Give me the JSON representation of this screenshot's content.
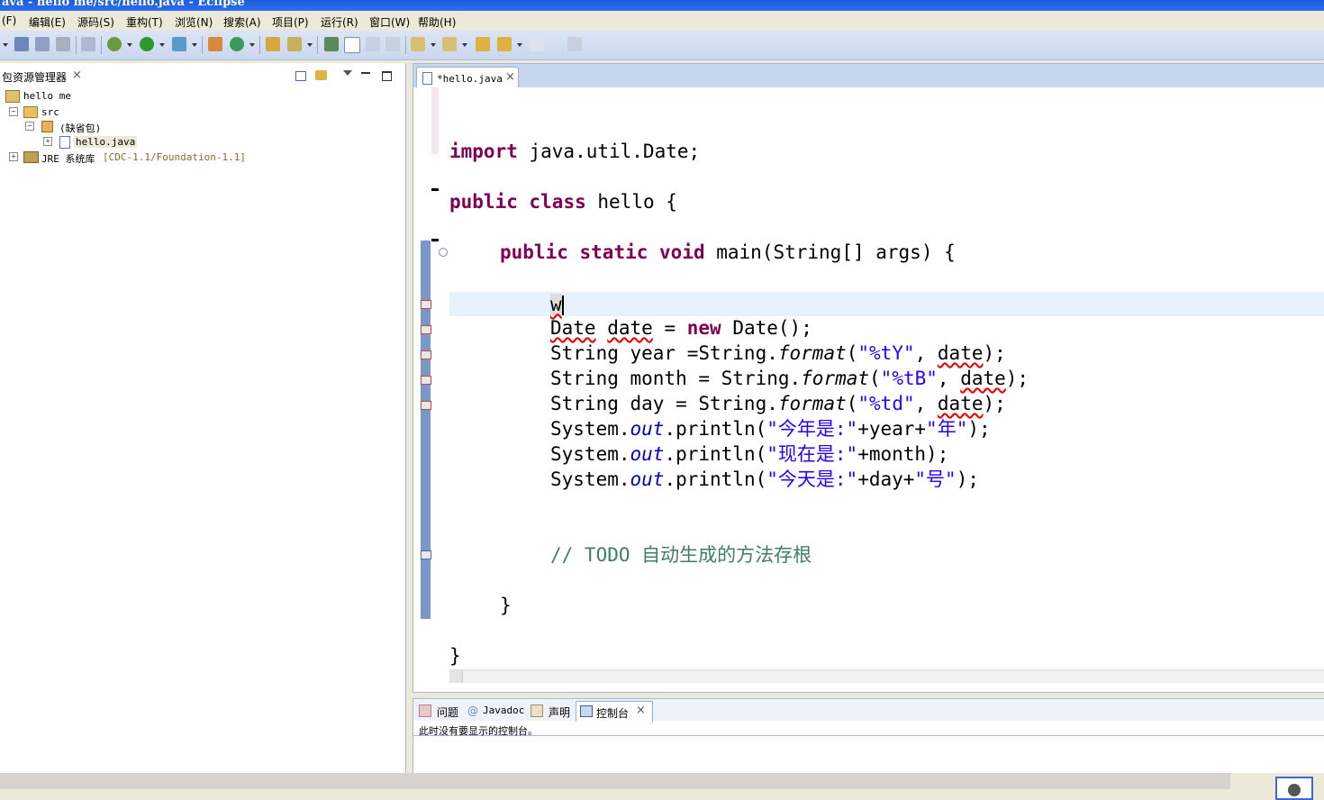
{
  "window": {
    "title": "ava - hello me/src/hello.java - Eclipse"
  },
  "menu": [
    {
      "label": "(F)"
    },
    {
      "label": "编辑(E)"
    },
    {
      "label": "源码(S)"
    },
    {
      "label": "重构(T)"
    },
    {
      "label": "浏览(N)"
    },
    {
      "label": "搜索(A)"
    },
    {
      "label": "项目(P)"
    },
    {
      "label": "运行(R)"
    },
    {
      "label": "窗口(W)"
    },
    {
      "label": "帮助(H)"
    }
  ],
  "package_explorer": {
    "title": "包资源管理器",
    "close": "×",
    "tree": [
      {
        "label": "hello me"
      },
      {
        "label": "src"
      },
      {
        "label": "(缺省包)"
      },
      {
        "label": "hello.java"
      },
      {
        "label": "JRE 系统库",
        "detail": "[CDC-1.1/Foundation-1.1]"
      }
    ]
  },
  "editor": {
    "tab_label": "*hello.java",
    "close": "×",
    "code": {
      "l1_kw": "import",
      "l1_rest": " java.util.Date;",
      "l2_kw1": "public",
      "l2_kw2": "class",
      "l2_rest": " hello {",
      "l3_kw1": "public",
      "l3_kw2": "static",
      "l3_kw3": "void",
      "l3_rest": " main(String[] args) {",
      "l4": "w",
      "l5_a": "Date",
      "l5_b": "date",
      "l5_c": " = ",
      "l5_kw": "new",
      "l5_d": " Date();",
      "l6_a": "String year =String.",
      "l6_it": "format",
      "l6_b": "(",
      "l6_str": "\"%tY\"",
      "l6_c": ", ",
      "l6_d": "date",
      "l6_e": ");",
      "l7_a": "String month = String.",
      "l7_it": "format",
      "l7_b": "(",
      "l7_str": "\"%tB\"",
      "l7_c": ", ",
      "l7_d": "date",
      "l7_e": ");",
      "l8_a": "String day = String.",
      "l8_it": "format",
      "l8_b": "(",
      "l8_str": "\"%td\"",
      "l8_c": ", ",
      "l8_d": "date",
      "l8_e": ");",
      "l9_a": "System.",
      "l9_it": "out",
      "l9_b": ".println(",
      "l9_str1": "\"今年是:\"",
      "l9_c": "+year+",
      "l9_str2": "\"年\"",
      "l9_d": ");",
      "l10_a": "System.",
      "l10_it": "out",
      "l10_b": ".println(",
      "l10_str": "\"现在是:\"",
      "l10_c": "+month);",
      "l11_a": "System.",
      "l11_it": "out",
      "l11_b": ".println(",
      "l11_str1": "\"今天是:\"",
      "l11_c": "+day+",
      "l11_str2": "\"号\"",
      "l11_d": ");",
      "l12": "// TODO 自动生成的方法存根",
      "l13": "}",
      "l14": "}"
    }
  },
  "bottom": {
    "tabs": [
      {
        "label": "问题"
      },
      {
        "label": "Javadoc"
      },
      {
        "label": "声明"
      },
      {
        "label": "控制台"
      }
    ],
    "close": "×",
    "console_message": "此时没有要显示的控制台。"
  },
  "colors": {
    "keyword": "#7f0055",
    "string": "#2a00ff",
    "comment": "#3f7f5f",
    "field": "#0000c0"
  }
}
